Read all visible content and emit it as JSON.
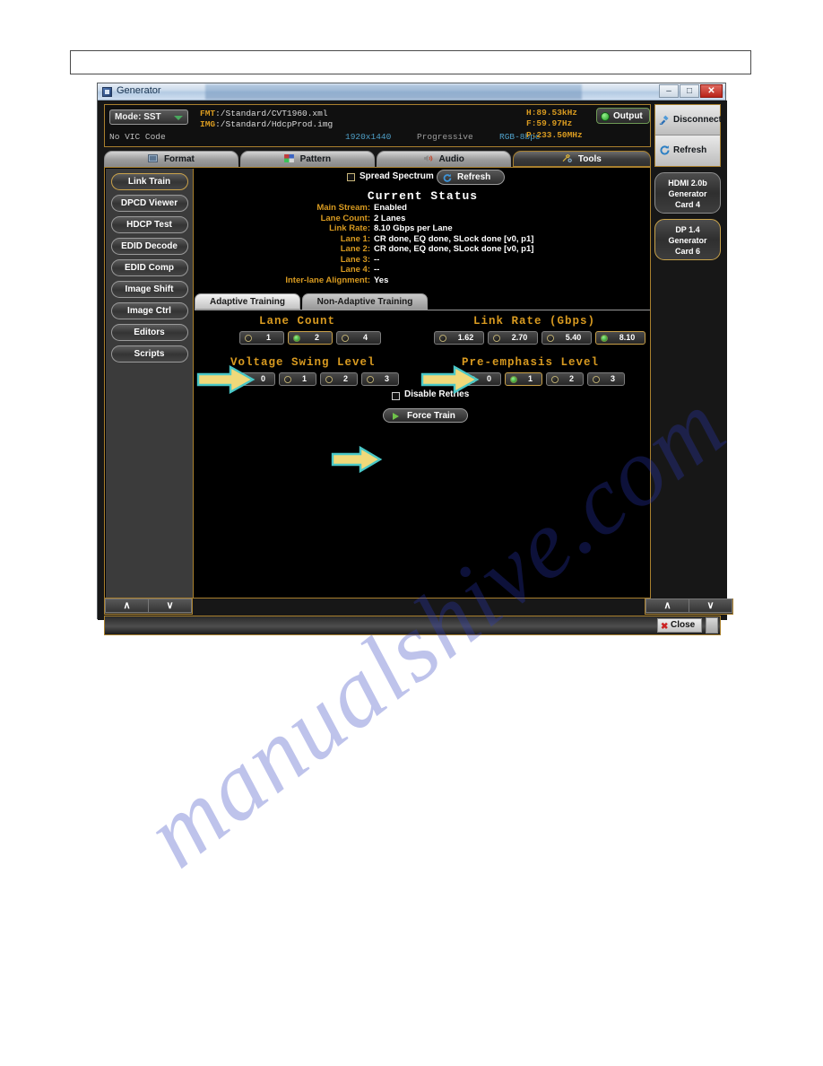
{
  "window": {
    "title": "Generator",
    "minimize_label": "–",
    "maximize_label": "□",
    "close_label": "✕"
  },
  "header": {
    "mode_button": "Mode: SST",
    "fmt_key": "FMT",
    "fmt_value": ":/Standard/CVT1960.xml",
    "img_key": "IMG",
    "img_value": ":/Standard/HdcpProd.img",
    "vic_code": "No VIC Code",
    "resolution": "1920x1440",
    "scan": "Progressive",
    "color_depth": "RGB-8bpc",
    "h_freq": "H:89.53kHz",
    "v_freq": "F:59.97Hz",
    "pixel_clock": "P:233.50MHz",
    "output_button": "Output"
  },
  "right_panel": {
    "disconnect": "Disconnect",
    "refresh": "Refresh",
    "cards": [
      {
        "lines": [
          "HDMI 2.0b",
          "Generator",
          "Card 4"
        ],
        "selected": false
      },
      {
        "lines": [
          "DP 1.4",
          "Generator",
          "Card 6"
        ],
        "selected": true
      }
    ]
  },
  "tabs": [
    {
      "label": "Format",
      "icon": "format-icon",
      "active": false
    },
    {
      "label": "Pattern",
      "icon": "pattern-icon",
      "active": false
    },
    {
      "label": "Audio",
      "icon": "audio-icon",
      "active": false
    },
    {
      "label": "Tools",
      "icon": "tools-icon",
      "active": true
    }
  ],
  "sidebar": {
    "items": [
      {
        "label": "Link Train",
        "selected": true
      },
      {
        "label": "DPCD Viewer",
        "selected": false
      },
      {
        "label": "HDCP Test",
        "selected": false
      },
      {
        "label": "EDID Decode",
        "selected": false
      },
      {
        "label": "EDID Comp",
        "selected": false
      },
      {
        "label": "Image Shift",
        "selected": false
      },
      {
        "label": "Image Ctrl",
        "selected": false
      },
      {
        "label": "Editors",
        "selected": false
      },
      {
        "label": "Scripts",
        "selected": false
      }
    ]
  },
  "toolbar": {
    "spread_spectrum_label": "Spread Spectrum",
    "spread_spectrum_checked": false,
    "refresh_label": "Refresh"
  },
  "status": {
    "title": "Current Status",
    "rows": [
      {
        "key": "Main Stream:",
        "value": "Enabled"
      },
      {
        "key": "Lane Count:",
        "value": "2 Lanes"
      },
      {
        "key": "Link Rate:",
        "value": "8.10 Gbps per Lane"
      },
      {
        "key": "Lane 1:",
        "value": "CR done, EQ done, SLock done [v0, p1]"
      },
      {
        "key": "Lane 2:",
        "value": "CR done, EQ done, SLock done [v0, p1]"
      },
      {
        "key": "Lane 3:",
        "value": "--"
      },
      {
        "key": "Lane 4:",
        "value": "--"
      },
      {
        "key": "Inter-lane Alignment:",
        "value": "Yes"
      }
    ]
  },
  "subtabs": [
    {
      "label": "Adaptive Training",
      "active": true
    },
    {
      "label": "Non-Adaptive Training",
      "active": false
    }
  ],
  "groups": {
    "lane_count": {
      "title": "Lane Count",
      "options": [
        {
          "label": "1",
          "selected": false
        },
        {
          "label": "2",
          "selected": true
        },
        {
          "label": "4",
          "selected": false
        }
      ]
    },
    "link_rate": {
      "title": "Link Rate (Gbps)",
      "options": [
        {
          "label": "1.62",
          "selected": false
        },
        {
          "label": "2.70",
          "selected": false
        },
        {
          "label": "5.40",
          "selected": false
        },
        {
          "label": "8.10",
          "selected": true
        }
      ]
    },
    "voltage_swing": {
      "title": "Voltage Swing Level",
      "options": [
        {
          "label": "0",
          "selected": false
        },
        {
          "label": "1",
          "selected": false
        },
        {
          "label": "2",
          "selected": false
        },
        {
          "label": "3",
          "selected": false
        }
      ]
    },
    "pre_emphasis": {
      "title": "Pre-emphasis Level",
      "options": [
        {
          "label": "0",
          "selected": false
        },
        {
          "label": "1",
          "selected": true
        },
        {
          "label": "2",
          "selected": false
        },
        {
          "label": "3",
          "selected": false
        }
      ]
    }
  },
  "actions": {
    "disable_retries_label": "Disable Retries",
    "disable_retries_checked": false,
    "force_train_label": "Force Train"
  },
  "scroll": {
    "up": "∧",
    "down": "∨"
  },
  "footer": {
    "close_label": "Close",
    "close_mark": "✖"
  },
  "watermark": {
    "text": "manualshive.com"
  },
  "colors": {
    "accent_orange": "#d89a20",
    "panel_border": "#a9802e",
    "led_green": "#2bb02b",
    "arrow_fill": "#f0d97a",
    "arrow_stroke": "#49c7c7",
    "close_red": "#cc2222"
  }
}
